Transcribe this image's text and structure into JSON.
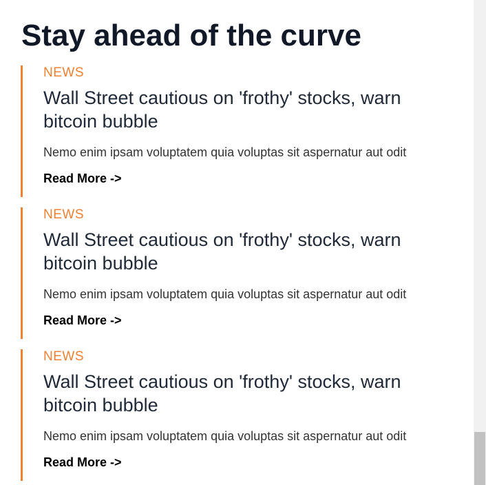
{
  "heading": "Stay ahead of the curve",
  "articles": [
    {
      "category": "NEWS",
      "title": "Wall Street cautious on 'frothy' stocks, warn bitcoin bubble",
      "excerpt": "Nemo enim ipsam voluptatem quia voluptas sit aspernatur aut odit",
      "link": "Read More ->"
    },
    {
      "category": "NEWS",
      "title": "Wall Street cautious on 'frothy' stocks, warn bitcoin bubble",
      "excerpt": "Nemo enim ipsam voluptatem quia voluptas sit aspernatur aut odit",
      "link": "Read More ->"
    },
    {
      "category": "NEWS",
      "title": "Wall Street cautious on 'frothy' stocks, warn bitcoin bubble",
      "excerpt": "Nemo enim ipsam voluptatem quia voluptas sit aspernatur aut odit",
      "link": "Read More ->"
    }
  ],
  "colors": {
    "accent": "#f08032",
    "heading": "#111827",
    "title": "#1f2937",
    "text": "#333333"
  }
}
